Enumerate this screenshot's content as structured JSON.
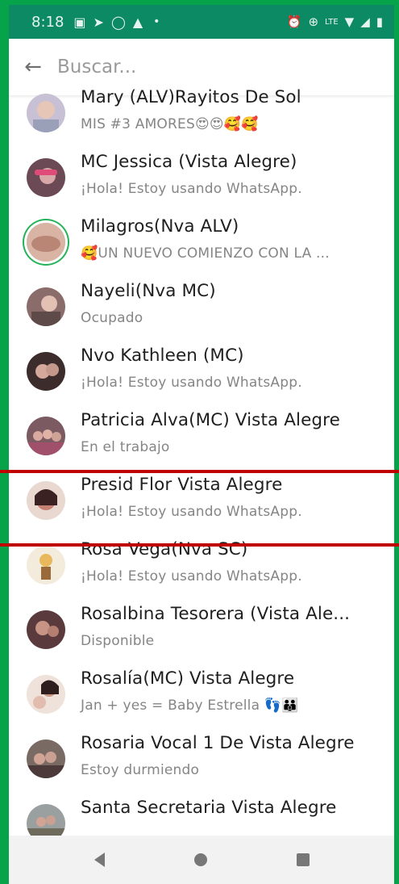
{
  "statusbar": {
    "time": "8:18"
  },
  "search": {
    "placeholder": "Buscar..."
  },
  "contacts": [
    {
      "name": "Mary (ALV)Rayitos De Sol",
      "status": "MIS #3 AMORES😍😍🥰🥰",
      "avatar_color": "#b9b2c8"
    },
    {
      "name": "MC Jessica (Vista Alegre)",
      "status": "¡Hola! Estoy usando WhatsApp.",
      "avatar_color": "#6b4a55"
    },
    {
      "name": "Milagros(Nva ALV)",
      "status": "🥰UN NUEVO COMIENZO  CON LA ...",
      "avatar_color": "#c9a090"
    },
    {
      "name": "Nayeli(Nva MC)",
      "status": "Ocupado",
      "avatar_color": "#8a6d6a"
    },
    {
      "name": "Nvo Kathleen (MC)",
      "status": "¡Hola! Estoy usando WhatsApp.",
      "avatar_color": "#3c2c2c"
    },
    {
      "name": "Patricia Alva(MC) Vista Alegre",
      "status": "En el trabajo",
      "avatar_color": "#7c5a62"
    },
    {
      "name": "Presid Flor Vista Alegre",
      "status": "¡Hola! Estoy usando WhatsApp.",
      "avatar_color": "#a46b5e"
    },
    {
      "name": "Rosa Vega(Nva SC)",
      "status": "¡Hola! Estoy usando WhatsApp.",
      "avatar_color": "#e3d6b8"
    },
    {
      "name": "Rosalbina Tesorera (Vista Ale...",
      "status": "Disponible",
      "avatar_color": "#5a3a3c"
    },
    {
      "name": "Rosalía(MC) Vista Alegre",
      "status": "Jan + yes = Baby Estrella 👣👪",
      "avatar_color": "#c59a8a"
    },
    {
      "name": "Rosaria Vocal 1 De Vista Alegre",
      "status": "Estoy durmiendo",
      "avatar_color": "#7a6a64"
    },
    {
      "name": "Santa Secretaria Vista Alegre",
      "status": "",
      "avatar_color": "#6e6a5c"
    }
  ]
}
